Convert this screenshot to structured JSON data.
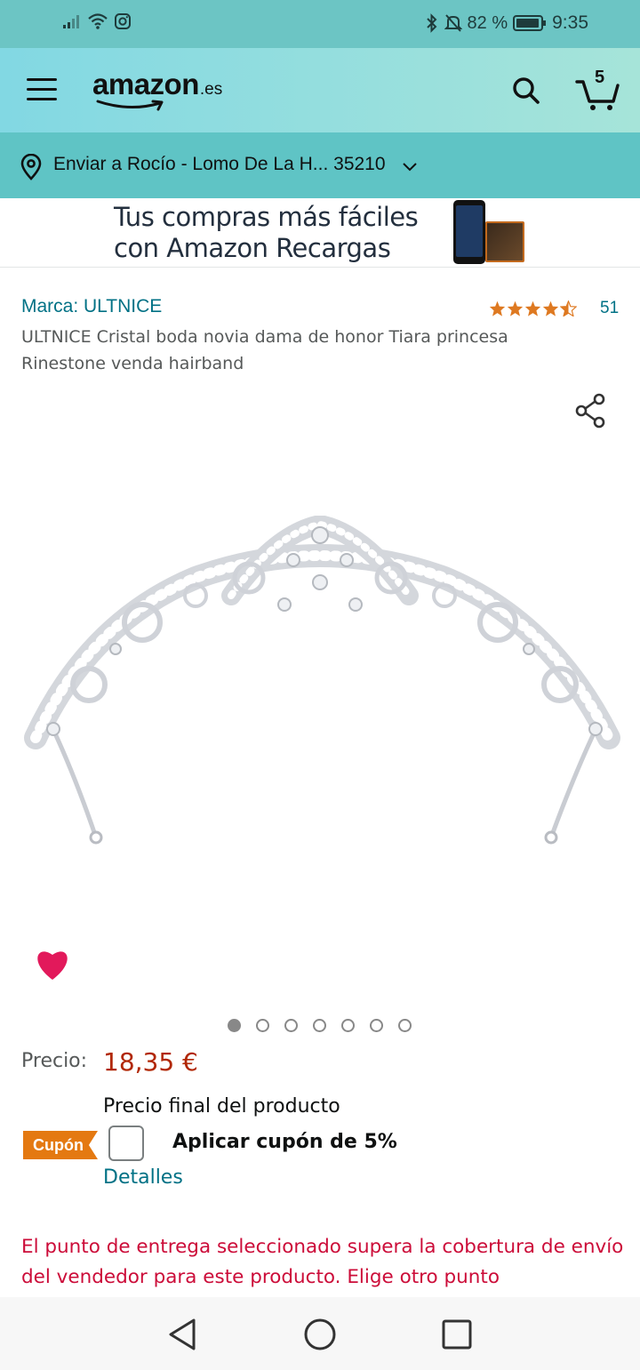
{
  "status_bar": {
    "battery": "82 %",
    "time": "9:35"
  },
  "header": {
    "logo": "amazon",
    "logo_tld": ".es",
    "cart_count": "5"
  },
  "location": {
    "text": "Enviar a Rocío - Lomo De La H... 35210"
  },
  "banner": {
    "line1": "Tus compras más fáciles",
    "line2": "con Amazon Recargas"
  },
  "product": {
    "brand": "Marca: ULTNICE",
    "rating": 4.5,
    "rating_count": "51",
    "title": "ULTNICE Cristal boda novia dama de honor Tiara princesa Rinestone venda hairband",
    "image_count": 7,
    "active_image": 1
  },
  "price": {
    "label": "Precio:",
    "value": "18,35 €",
    "note": "Precio final del producto"
  },
  "coupon": {
    "badge": "Cupón",
    "text": "Aplicar cupón de 5%",
    "details": "Detalles"
  },
  "warning": "El punto de entrega seleccionado supera la cobertura de envío del vendedor para este producto. Elige otro punto",
  "colors": {
    "header_start": "#82d8e3",
    "header_end": "#a6e4d9",
    "location_bar": "#5fc4c5",
    "link": "#007185",
    "price": "#b12704",
    "coupon_badge": "#e47911",
    "warning": "#cc0c39",
    "wishlist": "#e2195b",
    "stars": "#de7921"
  }
}
